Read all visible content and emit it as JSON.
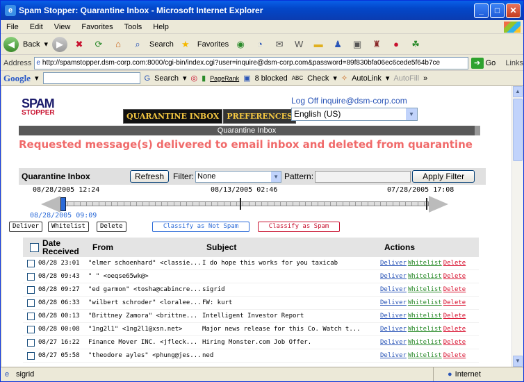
{
  "window": {
    "title": "Spam Stopper: Quarantine Inbox - Microsoft Internet Explorer"
  },
  "menu": [
    "File",
    "Edit",
    "View",
    "Favorites",
    "Tools",
    "Help"
  ],
  "toolbar": {
    "back": "Back",
    "search": "Search",
    "favorites": "Favorites"
  },
  "address": {
    "label": "Address",
    "url": "http://spamstopper.dsm-corp.com:8000/cgi-bin/index.cgi?user=inquire@dsm-corp.com&password=89f830bfa06ec6cede5f64b7ce",
    "go": "Go",
    "links": "Links"
  },
  "google": {
    "logo": "Google",
    "search": "Search",
    "pagerank": "PageRank",
    "blocked": "8 blocked",
    "check": "Check",
    "autolink": "AutoLink",
    "autofill": "AutoFill"
  },
  "app": {
    "logo_top": "SPAM",
    "logo_bottom": "STOPPER",
    "tabs": [
      "QUARANTINE INBOX",
      "PREFERENCES"
    ],
    "logoff": "Log Off inquire@dsm-corp.com",
    "language": "English (US)",
    "section_header": "Quarantine Inbox",
    "notice": "Requested message(s) delivered to email inbox and deleted from quarantine",
    "filter": {
      "title": "Quarantine Inbox",
      "refresh": "Refresh",
      "filter_label": "Filter:",
      "filter_value": "None",
      "pattern_label": "Pattern:",
      "apply": "Apply Filter"
    },
    "timeline": {
      "left": "08/28/2005 12:24",
      "mid": "08/13/2005 02:46",
      "right": "07/28/2005 17:08",
      "selected": "08/28/2005 09:09"
    },
    "buttons": {
      "deliver": "Deliver",
      "whitelist": "Whitelist",
      "delete": "Delete",
      "not_spam": "Classify as Not Spam",
      "spam": "Classify as Spam"
    },
    "columns": {
      "date": "Date Received",
      "from": "From",
      "subject": "Subject",
      "actions": "Actions"
    },
    "row_actions": {
      "deliver": "Deliver",
      "whitelist": "Whitelist",
      "delete": "Delete"
    },
    "rows": [
      {
        "date": "08/28 23:01",
        "from": "\"elmer schoenhard\" <classie...",
        "subject": "I do hope this works for you taxicab"
      },
      {
        "date": "08/28 09:43",
        "from": "\" \" <oeqse65wk@>",
        "subject": ""
      },
      {
        "date": "08/28 09:27",
        "from": "\"ed garmon\" <tosha@cabincre...",
        "subject": "sigrid"
      },
      {
        "date": "08/28 06:33",
        "from": "\"wilbert schroder\" <loralee...",
        "subject": "FW: kurt"
      },
      {
        "date": "08/28 00:13",
        "from": "\"Brittney Zamora\" <brittne...",
        "subject": "Intelligent Investor Report"
      },
      {
        "date": "08/28 00:08",
        "from": "\"1ng2l1\" <1ng2l1@xsn.net>",
        "subject": "Major news release for this Co. Watch t..."
      },
      {
        "date": "08/27 16:22",
        "from": "Finance Mover INC. <jfleck...",
        "subject": "Hiring Monster.com Job Offer."
      },
      {
        "date": "08/27 05:58",
        "from": "\"theodore ayles\" <phung@jes...",
        "subject": "ned"
      }
    ]
  },
  "status": {
    "left": "sigrid",
    "zone": "Internet"
  }
}
